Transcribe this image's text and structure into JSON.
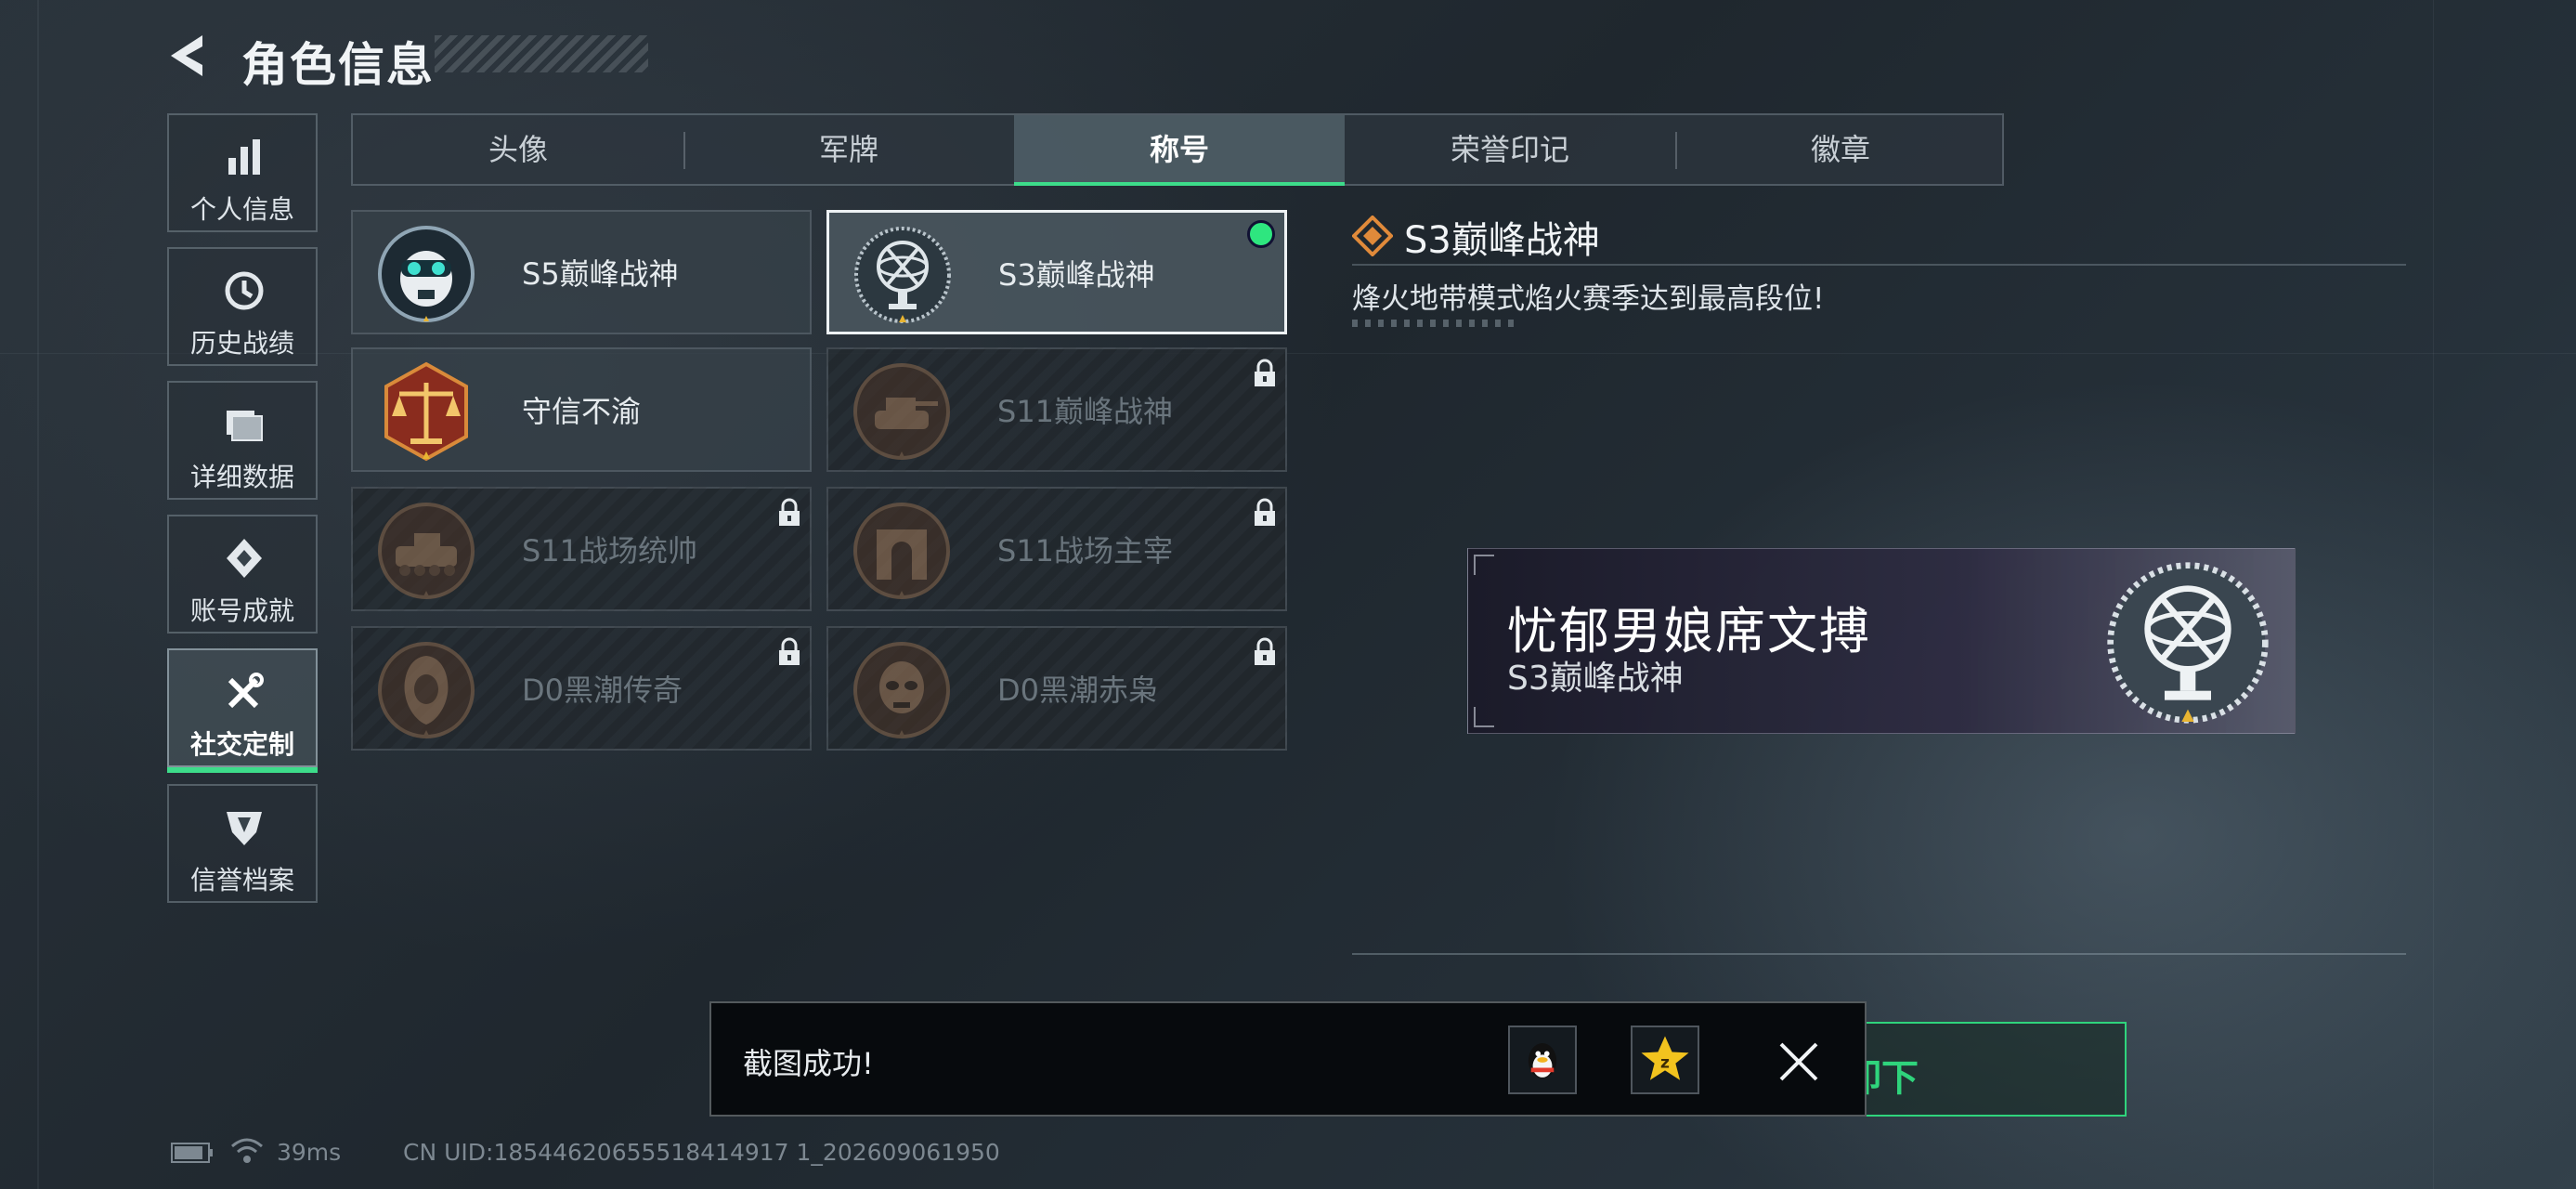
{
  "header": {
    "title": "角色信息"
  },
  "sidebar": {
    "items": [
      {
        "label": "个人信息",
        "icon": "bar-chart-icon",
        "active": false
      },
      {
        "label": "历史战绩",
        "icon": "clock-icon",
        "active": false
      },
      {
        "label": "详细数据",
        "icon": "folder-icon",
        "active": false
      },
      {
        "label": "账号成就",
        "icon": "achievement-icon",
        "active": false
      },
      {
        "label": "社交定制",
        "icon": "tools-icon",
        "active": true
      },
      {
        "label": "信誉档案",
        "icon": "shield-icon",
        "active": false
      }
    ]
  },
  "tabs": [
    {
      "label": "头像",
      "active": false
    },
    {
      "label": "军牌",
      "active": false
    },
    {
      "label": "称号",
      "active": true
    },
    {
      "label": "荣誉印记",
      "active": false
    },
    {
      "label": "徽章",
      "active": false
    }
  ],
  "titles": [
    {
      "label": "S5巅峰战神",
      "emblem": "skull-helmet-emblem",
      "locked": false,
      "selected": false
    },
    {
      "label": "S3巅峰战神",
      "emblem": "armillary-sphere-emblem",
      "locked": false,
      "selected": true
    },
    {
      "label": "守信不渝",
      "emblem": "scales-emblem",
      "locked": false,
      "selected": false
    },
    {
      "label": "S11巅峰战神",
      "emblem": "tank-emblem",
      "locked": true,
      "selected": false
    },
    {
      "label": "S11战场统帅",
      "emblem": "armored-vehicle-emblem",
      "locked": true,
      "selected": false
    },
    {
      "label": "S11战场主宰",
      "emblem": "arch-emblem",
      "locked": true,
      "selected": false
    },
    {
      "label": "D0黑潮传奇",
      "emblem": "hooded-figure-emblem",
      "locked": true,
      "selected": false
    },
    {
      "label": "D0黑潮赤枭",
      "emblem": "skull-mask-emblem",
      "locked": true,
      "selected": false
    }
  ],
  "detail": {
    "title": "S3巅峰战神",
    "description": "烽火地带模式焰火赛季达到最高段位!"
  },
  "preview": {
    "player_name": "忧郁男娘席文搏",
    "title": "S3巅峰战神"
  },
  "unequip_button": {
    "label": "卸下"
  },
  "toast": {
    "text": "截图成功!"
  },
  "status": {
    "ping": "39ms",
    "uid": "CN UID:18544620655518414917 1_202609061950"
  },
  "colors": {
    "accent_green": "#2fd47c",
    "selected_dot": "#2ee67f",
    "badge_gold": "#e8b431"
  }
}
